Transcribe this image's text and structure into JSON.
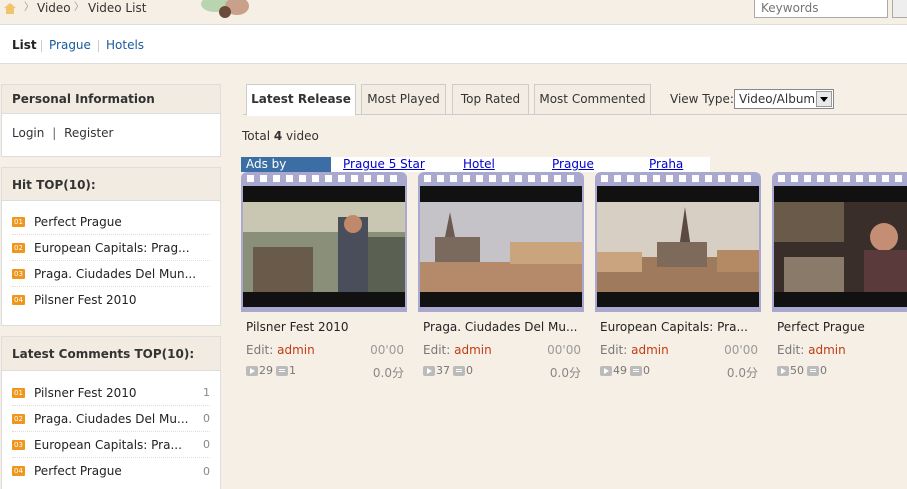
{
  "breadcrumb": {
    "items": [
      "Video",
      "Video List"
    ]
  },
  "search": {
    "placeholder": "Keywords"
  },
  "subnav": {
    "items": [
      "List",
      "Prague",
      "Hotels"
    ]
  },
  "sidebar": {
    "personal": {
      "title": "Personal Information",
      "login": "Login",
      "sep": "|",
      "register": "Register"
    },
    "hit_top": {
      "title": "Hit TOP(10):",
      "items": [
        {
          "rank": "01",
          "title": "Perfect Prague"
        },
        {
          "rank": "02",
          "title": "European Capitals: Prag..."
        },
        {
          "rank": "03",
          "title": "Praga. Ciudades Del Mun..."
        },
        {
          "rank": "04",
          "title": "Pilsner Fest 2010"
        }
      ]
    },
    "latest_comments": {
      "title": "Latest Comments TOP(10):",
      "items": [
        {
          "rank": "01",
          "title": "Pilsner Fest 2010",
          "count": "1"
        },
        {
          "rank": "02",
          "title": "Praga. Ciudades Del Mu...",
          "count": "0"
        },
        {
          "rank": "03",
          "title": "European Capitals: Pra...",
          "count": "0"
        },
        {
          "rank": "04",
          "title": "Perfect Prague",
          "count": "0"
        }
      ]
    }
  },
  "main": {
    "tabs": [
      "Latest Release",
      "Most Played",
      "Top Rated",
      "Most Commented"
    ],
    "view_type": {
      "label": "View Type:",
      "value": "Video/Album"
    },
    "total": {
      "prefix": "Total",
      "count": "4",
      "suffix": "video"
    },
    "ads": {
      "label": "Ads by Google",
      "links": [
        "Prague 5 Star",
        "Hotel",
        "Prague",
        "Praha"
      ]
    },
    "videos": [
      {
        "title": "Pilsner Fest 2010",
        "edit_label": "Edit:",
        "author": "admin",
        "duration": "00'00",
        "plays": "29",
        "comments": "1",
        "rating": "0.0分"
      },
      {
        "title": "Praga. Ciudades Del Mu...",
        "edit_label": "Edit:",
        "author": "admin",
        "duration": "00'00",
        "plays": "37",
        "comments": "0",
        "rating": "0.0分"
      },
      {
        "title": "European Capitals: Pra...",
        "edit_label": "Edit:",
        "author": "admin",
        "duration": "00'00",
        "plays": "49",
        "comments": "0",
        "rating": "0.0分"
      },
      {
        "title": "Perfect Prague",
        "edit_label": "Edit:",
        "author": "admin",
        "duration": "",
        "plays": "50",
        "comments": "0",
        "rating": ""
      }
    ]
  },
  "colors": {
    "accent_orange": "#f0961c",
    "author_red": "#c03c14",
    "film_purple": "#a9a8cf",
    "link_blue": "#1a5a9c"
  }
}
